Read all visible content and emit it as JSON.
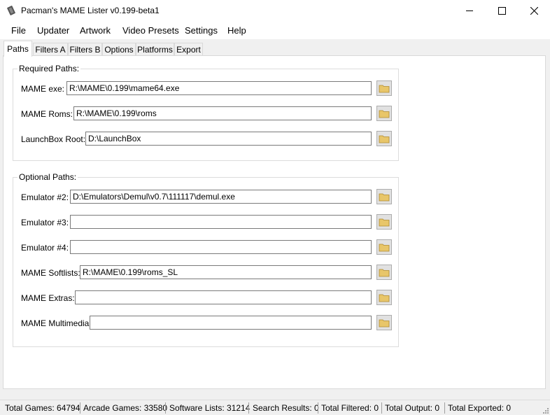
{
  "window": {
    "title": "Pacman's MAME Lister v0.199-beta1"
  },
  "menu": [
    "File",
    "Updater",
    "Artwork",
    "Video Presets",
    "Settings",
    "Help"
  ],
  "tabs": [
    "Paths",
    "Filters A",
    "Filters B",
    "Options",
    "Platforms",
    "Export"
  ],
  "required": {
    "title": "Required Paths:",
    "fields": [
      {
        "label": "MAME exe:",
        "value": "R:\\MAME\\0.199\\mame64.exe"
      },
      {
        "label": "MAME Roms:",
        "value": "R:\\MAME\\0.199\\roms"
      },
      {
        "label": "LaunchBox Root:",
        "value": "D:\\LaunchBox"
      }
    ]
  },
  "optional": {
    "title": "Optional Paths:",
    "fields": [
      {
        "label": "Emulator #2:",
        "value": "D:\\Emulators\\Demul\\v0.7\\111117\\demul.exe"
      },
      {
        "label": "Emulator #3:",
        "value": ""
      },
      {
        "label": "Emulator #4:",
        "value": ""
      },
      {
        "label": "MAME Softlists:",
        "value": "R:\\MAME\\0.199\\roms_SL"
      },
      {
        "label": "MAME Extras:",
        "value": ""
      },
      {
        "label": "MAME Multimedia:",
        "value": ""
      }
    ]
  },
  "status": [
    "Total Games: 64794",
    "Arcade Games: 33580",
    "Software Lists: 31214",
    "Search Results: 0",
    "Total Filtered: 0",
    "Total Output: 0",
    "Total Exported: 0"
  ],
  "icons": {
    "app": "joystick-icon",
    "browse": "folder-icon",
    "folder_color": "#e8c66a"
  }
}
